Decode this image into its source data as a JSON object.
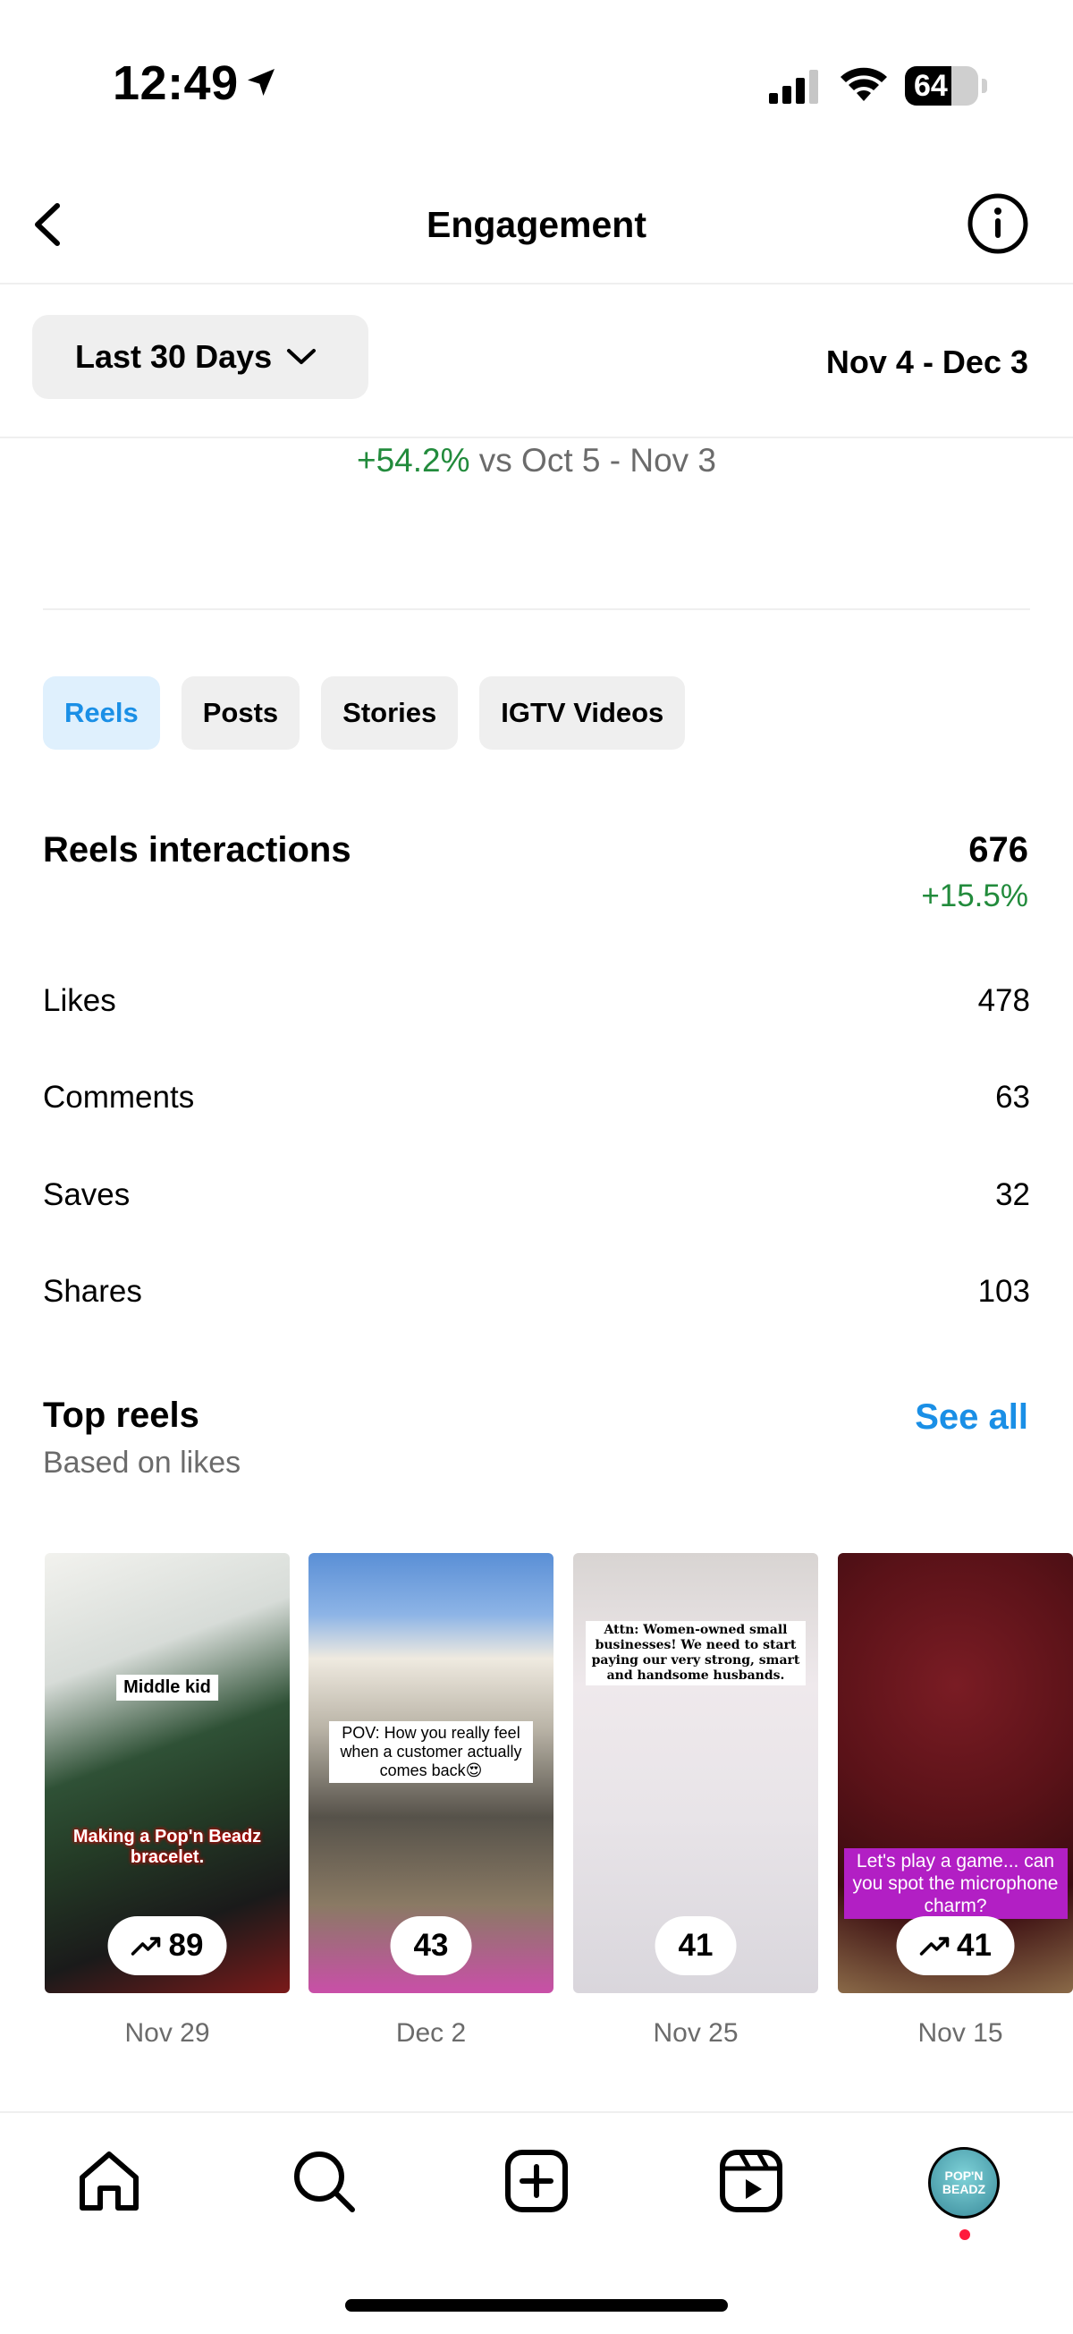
{
  "status_bar": {
    "time": "12:49",
    "battery": "64",
    "battery_level": 0.64
  },
  "nav": {
    "title": "Engagement"
  },
  "date_filter": {
    "range_label": "Last 30 Days",
    "date_range": "Nov 4 - Dec 3"
  },
  "comparison": {
    "change": "+54.2%",
    "vs_text": "vs Oct 5 - Nov 3"
  },
  "tabs": [
    {
      "label": "Reels",
      "active": true
    },
    {
      "label": "Posts",
      "active": false
    },
    {
      "label": "Stories",
      "active": false
    },
    {
      "label": "IGTV Videos",
      "active": false
    }
  ],
  "interactions": {
    "title": "Reels interactions",
    "total": "676",
    "change": "+15.5%",
    "metrics": [
      {
        "label": "Likes",
        "value": "478"
      },
      {
        "label": "Comments",
        "value": "63"
      },
      {
        "label": "Saves",
        "value": "32"
      },
      {
        "label": "Shares",
        "value": "103"
      }
    ]
  },
  "top_reels": {
    "title": "Top reels",
    "subtitle": "Based on likes",
    "see_all": "See all",
    "items": [
      {
        "top_text": "Middle kid",
        "bottom_text": "Making a Pop'n Beadz bracelet.",
        "count": "89",
        "trending": true,
        "date": "Nov 29"
      },
      {
        "top_text": "POV: How you really feel when a customer actually comes back😍",
        "count": "43",
        "trending": false,
        "date": "Dec 2"
      },
      {
        "top_text": "Attn: Women-owned small businesses! We need to start paying our very strong, smart and handsome husbands.",
        "count": "41",
        "trending": false,
        "date": "Nov 25"
      },
      {
        "bottom_text": "Let's play a game... can you spot the microphone charm?",
        "count": "41",
        "trending": true,
        "date": "Nov 15"
      }
    ]
  },
  "tabbar": {
    "icons": [
      "home-icon",
      "search-icon",
      "create-icon",
      "reels-icon",
      "profile-avatar"
    ],
    "avatar_text": "POP'N BEADZ"
  },
  "colors": {
    "accent": "#1a8fe6",
    "positive": "#228b3c",
    "tab_active_bg": "#dff0fd"
  }
}
